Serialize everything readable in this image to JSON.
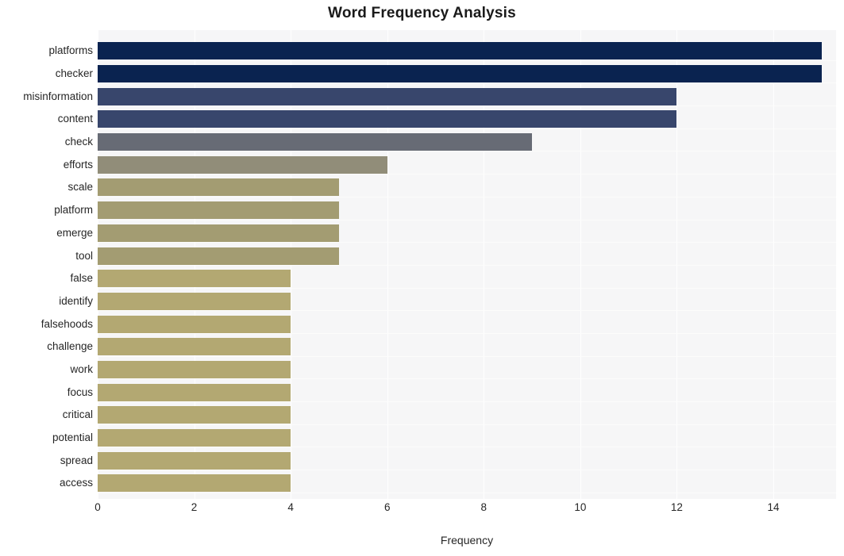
{
  "chart_data": {
    "type": "bar",
    "orientation": "horizontal",
    "title": "Word Frequency Analysis",
    "xlabel": "Frequency",
    "ylabel": "",
    "xlim": [
      0,
      15.3
    ],
    "ylim": null,
    "grid": true,
    "legend": null,
    "xticks": [
      0,
      2,
      4,
      6,
      8,
      10,
      12,
      14
    ],
    "xticklabels": [
      "0",
      "2",
      "4",
      "6",
      "8",
      "10",
      "12",
      "14"
    ],
    "categories": [
      "platforms",
      "checker",
      "misinformation",
      "content",
      "check",
      "efforts",
      "scale",
      "platform",
      "emerge",
      "tool",
      "false",
      "identify",
      "falsehoods",
      "challenge",
      "work",
      "focus",
      "critical",
      "potential",
      "spread",
      "access"
    ],
    "values": [
      15,
      15,
      12,
      12,
      9,
      6,
      5,
      5,
      5,
      5,
      4,
      4,
      4,
      4,
      4,
      4,
      4,
      4,
      4,
      4
    ],
    "bar_colors": [
      "#0a2350",
      "#0a2350",
      "#38466c",
      "#38466c",
      "#676b75",
      "#918d79",
      "#a39c72",
      "#a39c72",
      "#a39c72",
      "#a39c72",
      "#b3a872",
      "#b3a872",
      "#b3a872",
      "#b3a872",
      "#b3a872",
      "#b3a872",
      "#b3a872",
      "#b3a872",
      "#b3a872",
      "#b3a872"
    ],
    "plot_background": "#f6f6f7",
    "figure_background": "#ffffff"
  }
}
